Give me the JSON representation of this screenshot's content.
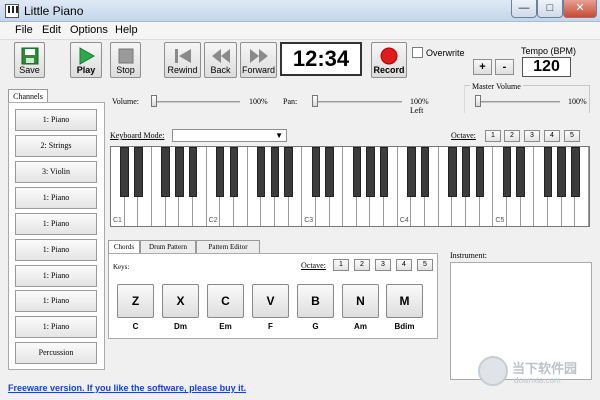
{
  "window": {
    "title": "Little Piano",
    "min": "—",
    "max": "□",
    "close": "✕"
  },
  "menu": [
    "File",
    "Edit",
    "Options",
    "Help"
  ],
  "toolbar": {
    "save": "Save",
    "play": "Play",
    "stop": "Stop",
    "rewind": "Rewind",
    "back": "Back",
    "forward": "Forward",
    "clock": "12:34",
    "record": "Record",
    "overwrite": "Overwrite",
    "tempo_label": "Tempo (BPM)",
    "tempo_plus": "+",
    "tempo_minus": "-",
    "tempo_value": "120"
  },
  "channels": {
    "tab": "Channels",
    "items": [
      "1: Piano",
      "2: Strings",
      "3: Violin",
      "1: Piano",
      "1: Piano",
      "1: Piano",
      "1: Piano",
      "1: Piano",
      "1: Piano",
      "Percussion"
    ]
  },
  "mixer": {
    "volume_label": "Volume:",
    "volume_value": "100%",
    "pan_label": "Pan:",
    "pan_value": "100%",
    "pan_side": "Left",
    "master_label": "Master Volume",
    "master_value": "100%"
  },
  "keyboard": {
    "mode_label": "Keyboard Mode:",
    "octave_label": "Octave:",
    "octaves": [
      "1",
      "2",
      "3",
      "4",
      "5"
    ],
    "c_labels": [
      "C1",
      "C2",
      "C3",
      "C4",
      "C5"
    ]
  },
  "tabs": [
    "Chords",
    "Drum Pattern",
    "Pattern Editor"
  ],
  "chords": {
    "keys_label": "Keys:",
    "octave_label": "Octave:",
    "octaves": [
      "1",
      "2",
      "3",
      "4",
      "5"
    ],
    "keys": [
      "Z",
      "X",
      "C",
      "V",
      "B",
      "N",
      "M"
    ],
    "names": [
      "C",
      "Dm",
      "Em",
      "F",
      "G",
      "Am",
      "Bdim"
    ]
  },
  "instrument_label": "Instrument:",
  "freeware": "Freeware version. If you like the software, please buy it.",
  "watermark": {
    "line1": "当下软件园",
    "line2": "downxia.com"
  }
}
